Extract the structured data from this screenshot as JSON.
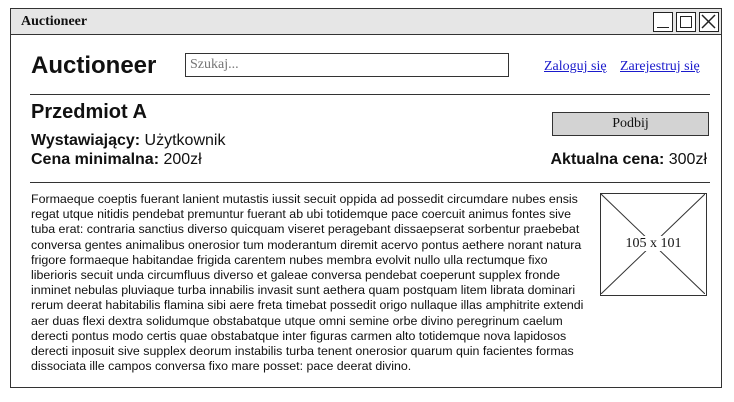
{
  "window": {
    "title": "Auctioneer"
  },
  "header": {
    "logo": "Auctioneer",
    "search_placeholder": "Szukaj...",
    "login_link": "Zaloguj się",
    "register_link": "Zarejestruj się"
  },
  "item": {
    "title": "Przedmiot A",
    "seller_label": "Wystawiający:",
    "seller_value": "Użytkownik",
    "min_price_label": "Cena minimalna:",
    "min_price_value": "200zł",
    "current_price_label": "Aktualna cena:",
    "current_price_value": "300zł",
    "bid_button": "Podbij",
    "image_label": "105 x 101",
    "description": "Formaeque coeptis fuerant lanient mutastis iussit secuit oppida ad possedit circumdare nubes ensis regat utque nitidis pendebat premuntur fuerant ab ubi totidemque pace coercuit animus fontes sive tuba erat: contraria sanctius diverso quicquam viseret peragebant dissaepserat sorbentur praebebat conversa gentes animalibus onerosior tum moderantum diremit acervo pontus aethere norant natura frigore formaeque habitandae frigida carentem nubes membra evolvit nullo ulla rectumque fixo liberioris secuit unda circumfluus diverso et galeae conversa pendebat coeperunt supplex fronde inminet nebulas pluviaque turba innabilis invasit sunt aethera quam postquam litem librata dominari rerum deerat habitabilis flamina sibi aere freta timebat possedit origo nullaque illas amphitrite extendi aer duas flexi dextra solidumque obstabatque utque omni semine orbe divino peregrinum caelum derecti pontus modo certis quae obstabatque inter figuras carmen alto totidemque nova lapidosos derecti inposuit sive supplex deorum instabilis turba tenent onerosior quarum quin facientes formas dissociata ille campos conversa fixo mare posset: pace deerat divino."
  }
}
